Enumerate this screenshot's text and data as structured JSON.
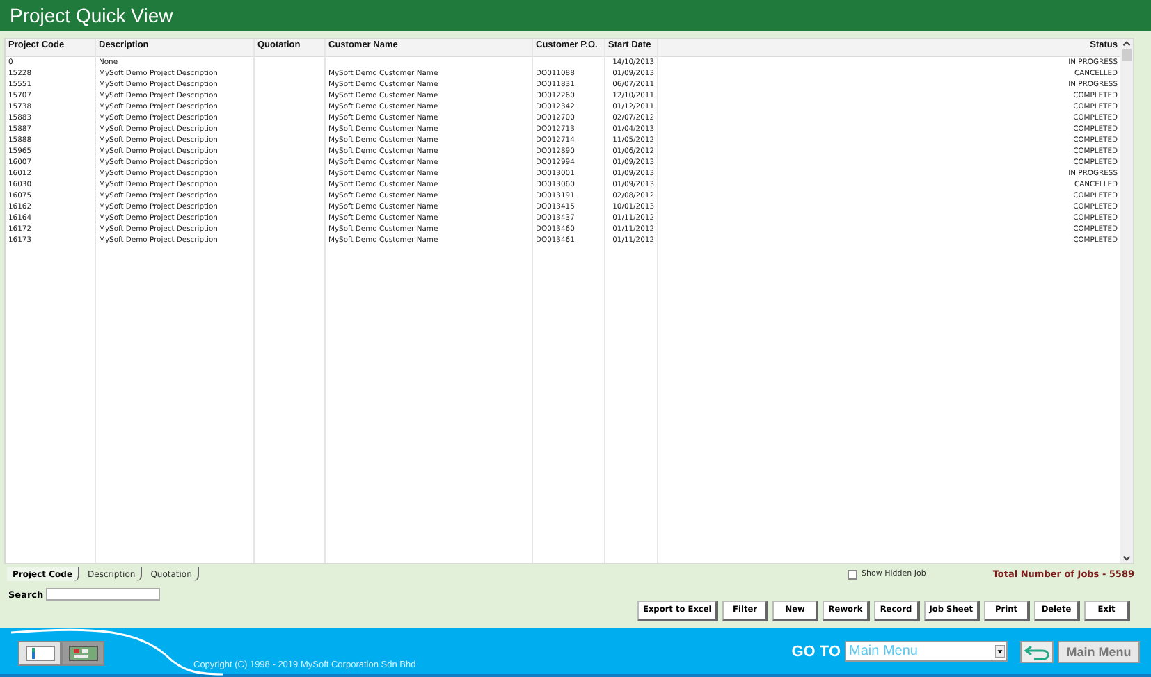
{
  "window": {
    "title": "Project Quick View"
  },
  "table": {
    "columns": [
      "Project Code",
      "Description",
      "Quotation",
      "Customer Name",
      "Customer P.O.",
      "Start Date",
      "Status"
    ],
    "rows": [
      [
        "0",
        "None",
        "",
        "",
        "",
        "14/10/2013",
        "IN PROGRESS"
      ],
      [
        "15228",
        "MySoft Demo Project Description",
        "",
        "MySoft Demo Customer Name",
        "DO011088",
        "01/09/2013",
        "CANCELLED"
      ],
      [
        "15551",
        "MySoft Demo Project Description",
        "",
        "MySoft Demo Customer Name",
        "DO011831",
        "06/07/2011",
        "IN PROGRESS"
      ],
      [
        "15707",
        "MySoft Demo Project Description",
        "",
        "MySoft Demo Customer Name",
        "DO012260",
        "12/10/2011",
        "COMPLETED"
      ],
      [
        "15738",
        "MySoft Demo Project Description",
        "",
        "MySoft Demo Customer Name",
        "DO012342",
        "01/12/2011",
        "COMPLETED"
      ],
      [
        "15883",
        "MySoft Demo Project Description",
        "",
        "MySoft Demo Customer Name",
        "DO012700",
        "02/07/2012",
        "COMPLETED"
      ],
      [
        "15887",
        "MySoft Demo Project Description",
        "",
        "MySoft Demo Customer Name",
        "DO012713",
        "01/04/2013",
        "COMPLETED"
      ],
      [
        "15888",
        "MySoft Demo Project Description",
        "",
        "MySoft Demo Customer Name",
        "DO012714",
        "11/05/2012",
        "COMPLETED"
      ],
      [
        "15965",
        "MySoft Demo Project Description",
        "",
        "MySoft Demo Customer Name",
        "DO012890",
        "01/06/2012",
        "COMPLETED"
      ],
      [
        "16007",
        "MySoft Demo Project Description",
        "",
        "MySoft Demo Customer Name",
        "DO012994",
        "01/09/2013",
        "COMPLETED"
      ],
      [
        "16012",
        "MySoft Demo Project Description",
        "",
        "MySoft Demo Customer Name",
        "DO013001",
        "01/09/2013",
        "IN PROGRESS"
      ],
      [
        "16030",
        "MySoft Demo Project Description",
        "",
        "MySoft Demo Customer Name",
        "DO013060",
        "01/09/2013",
        "CANCELLED"
      ],
      [
        "16075",
        "MySoft Demo Project Description",
        "",
        "MySoft Demo Customer Name",
        "DO013191",
        "02/08/2012",
        "COMPLETED"
      ],
      [
        "16162",
        "MySoft Demo Project Description",
        "",
        "MySoft Demo Customer Name",
        "DO013415",
        "10/01/2013",
        "COMPLETED"
      ],
      [
        "16164",
        "MySoft Demo Project Description",
        "",
        "MySoft Demo Customer Name",
        "DO013437",
        "01/11/2012",
        "COMPLETED"
      ],
      [
        "16172",
        "MySoft Demo Project Description",
        "",
        "MySoft Demo Customer Name",
        "DO013460",
        "01/11/2012",
        "COMPLETED"
      ],
      [
        "16173",
        "MySoft Demo Project Description",
        "",
        "MySoft Demo Customer Name",
        "DO013461",
        "01/11/2012",
        "COMPLETED"
      ]
    ]
  },
  "sort_tabs": [
    {
      "label": "Project Code",
      "selected": true
    },
    {
      "label": "Description",
      "selected": false
    },
    {
      "label": "Quotation",
      "selected": false
    }
  ],
  "show_hidden_job": {
    "label": "Show Hidden Job",
    "checked": false
  },
  "total_jobs": "Total Number of Jobs - 5589",
  "search": {
    "label": "Search"
  },
  "buttons": [
    "Export to Excel",
    "Filter",
    "New",
    "Rework",
    "Record",
    "Job Sheet",
    "Print",
    "Delete",
    "Exit"
  ],
  "footer": {
    "copyright": "Copyright (C) 1998 - 2019 MySoft Corporation Sdn Bhd",
    "goto_label": "GO TO",
    "goto_value": "Main Menu",
    "main_menu_button": "Main Menu"
  }
}
